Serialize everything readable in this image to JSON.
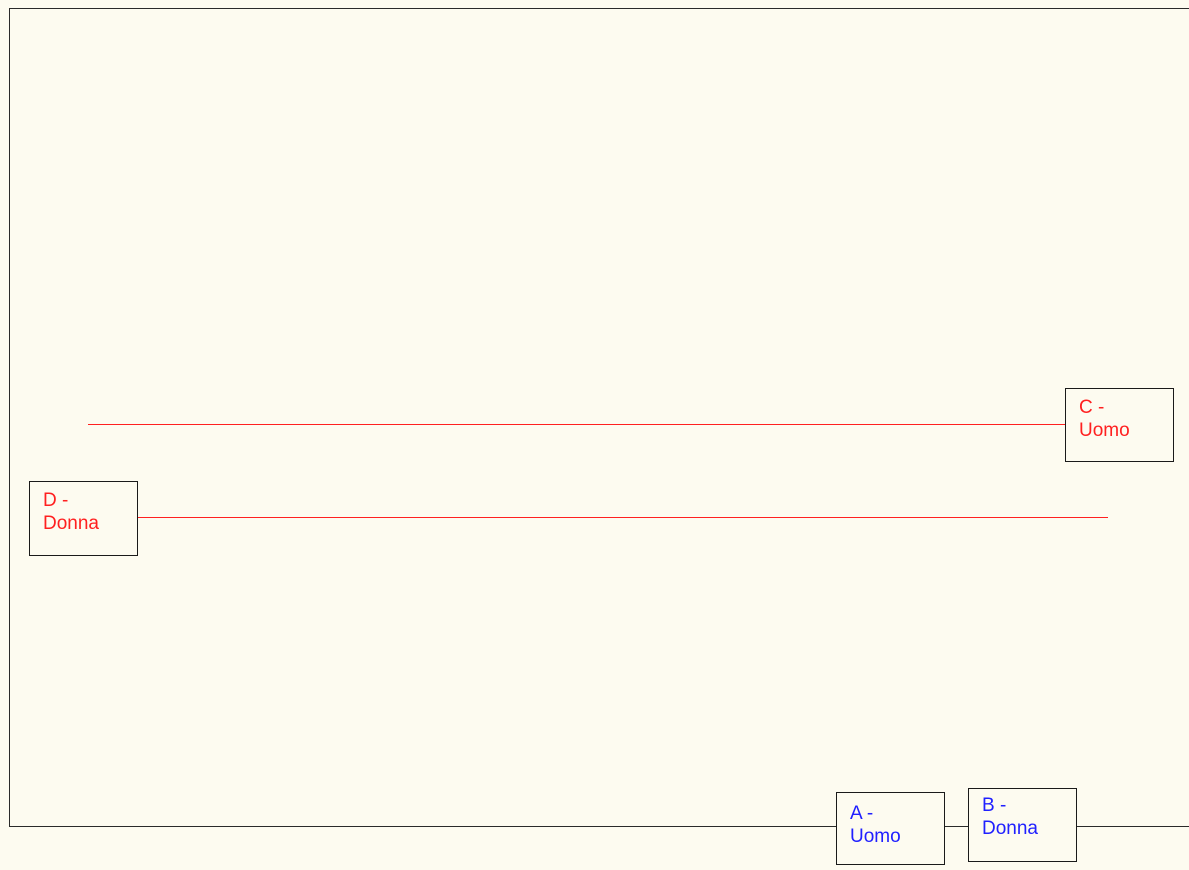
{
  "colors": {
    "background": "#fdfbf0",
    "border": "#1a1a1a",
    "line": "#ff2020",
    "node_red": "#ff2020",
    "node_blue": "#2020ff"
  },
  "nodes": {
    "a": {
      "line1": "A -",
      "line2": "Uomo",
      "color": "#2020ff"
    },
    "b": {
      "line1": "B -",
      "line2": "Donna",
      "color": "#2020ff"
    },
    "c": {
      "line1": "C -",
      "line2": "Uomo",
      "color": "#ff2020"
    },
    "d": {
      "line1": "D -",
      "line2": "Donna",
      "color": "#ff2020"
    }
  },
  "connections": [
    {
      "from": "c",
      "to": "d"
    },
    {
      "from": "d",
      "to": "c"
    }
  ]
}
